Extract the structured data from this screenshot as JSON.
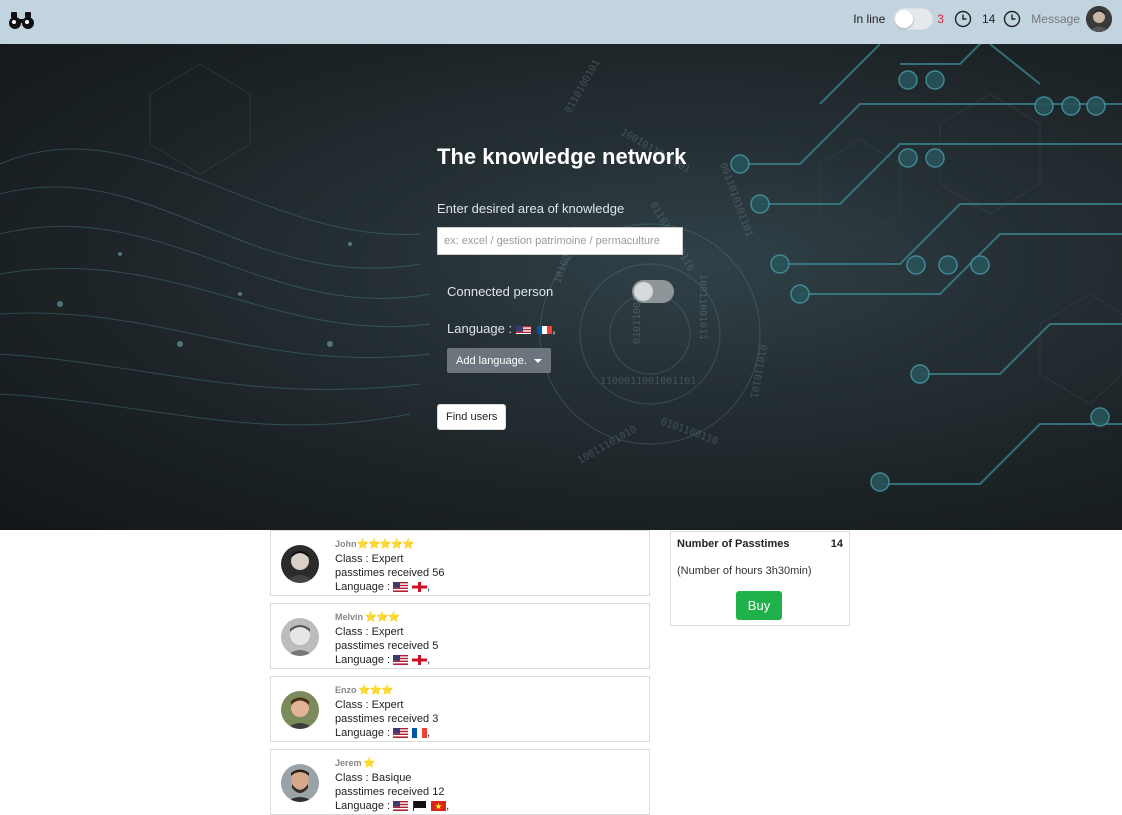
{
  "topbar": {
    "logo_icon": "binoculars-icon",
    "inline_label": "In line",
    "inline_count": "3",
    "clock_count": "14",
    "message_label": "Message"
  },
  "hero": {
    "title": "The knowledge network",
    "subtitle": "Enter desired area of knowledge",
    "search_placeholder": "ex: excel / gestion patrimoine / permaculture",
    "connected_label": "Connected person",
    "language_label": "Language : ",
    "language_flags": [
      "us",
      "fr"
    ],
    "language_suffix": ",",
    "add_language_label": "Add language.",
    "find_users_label": "Find users"
  },
  "users": [
    {
      "name": "John",
      "stars": "⭐⭐⭐⭐⭐",
      "class": "Class : Expert",
      "passtimes": "passtimes received 56",
      "language_label": "Language : ",
      "flags": [
        "us",
        "gb-eng"
      ]
    },
    {
      "name": "Melvin",
      "stars": " ⭐⭐⭐",
      "class": "Class : Expert",
      "passtimes": "passtimes received 5",
      "language_label": "Language : ",
      "flags": [
        "us",
        "gb-eng"
      ]
    },
    {
      "name": "Enzo",
      "stars": " ⭐⭐⭐",
      "class": "Class : Expert",
      "passtimes": "passtimes received 3",
      "language_label": "Language : ",
      "flags": [
        "us",
        "fr"
      ]
    },
    {
      "name": "Jerem",
      "stars": " ⭐",
      "class": "Class : Basique",
      "passtimes": "passtimes received 12",
      "language_label": "Language : ",
      "flags": [
        "us",
        "pirate",
        "vn"
      ]
    }
  ],
  "passtimes_panel": {
    "title": "Number of Passtimes",
    "count": "14",
    "hours": "(Number of hours 3h30min)",
    "buy_label": "Buy"
  },
  "colors": {
    "topbar": "#c3d4e1",
    "hero_dark": "#1d2427",
    "accent_red": "#d6283a",
    "buy_green": "#20b24a",
    "star_yellow": "#f4c20d"
  }
}
